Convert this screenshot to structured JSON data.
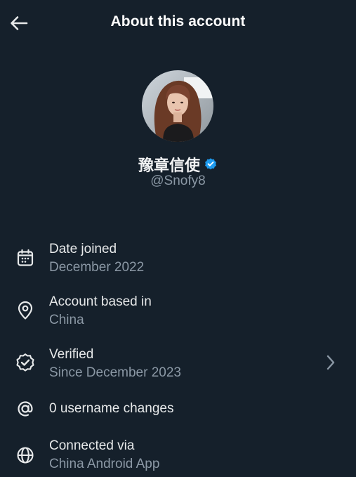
{
  "header": {
    "title": "About this account",
    "back_icon": "arrow-left-icon"
  },
  "profile": {
    "display_name": "豫章信使",
    "handle": "@Snofy8",
    "verified_badge_color": "#1d9bf0"
  },
  "details": [
    {
      "icon": "calendar-icon",
      "label": "Date joined",
      "value": "December 2022"
    },
    {
      "icon": "location-pin-icon",
      "label": "Account based in",
      "value": "China"
    },
    {
      "icon": "verified-icon",
      "label": "Verified",
      "value": "Since December 2023",
      "has_chevron": true
    },
    {
      "icon": "at-sign-icon",
      "label": "0 username changes"
    },
    {
      "icon": "globe-icon",
      "label": "Connected via",
      "value": "China Android App"
    }
  ],
  "colors": {
    "background": "#15202b",
    "primary_text": "#e7e9ea",
    "secondary_text": "#8b98a5",
    "accent": "#1d9bf0"
  }
}
